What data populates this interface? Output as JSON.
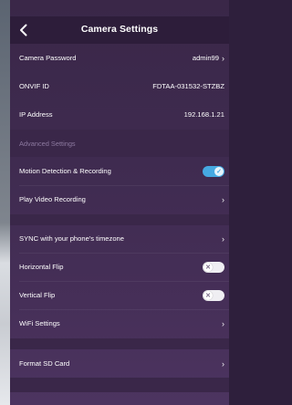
{
  "header": {
    "title": "Camera Settings"
  },
  "rows": {
    "camera_password": {
      "label": "Camera Password",
      "value": "admin99"
    },
    "onvif_id": {
      "label": "ONVIF ID",
      "value": "FDTAA-031532-STZBZ"
    },
    "ip_address": {
      "label": "IP Address",
      "value": "192.168.1.21"
    },
    "motion_detection": {
      "label": "Motion Detection & Recording",
      "state": "on"
    },
    "play_video_recording": {
      "label": "Play Video Recording"
    },
    "sync_timezone": {
      "label": "SYNC with your phone's timezone"
    },
    "horizontal_flip": {
      "label": "Horizontal Flip",
      "state": "off"
    },
    "vertical_flip": {
      "label": "Vertical Flip",
      "state": "off"
    },
    "wifi_settings": {
      "label": "WiFi Settings"
    },
    "format_sd_card": {
      "label": "Format SD Card"
    }
  },
  "sections": {
    "advanced": "Advanced Settings"
  },
  "glyphs": {
    "chevron": "›",
    "check": "✓",
    "cross": "✕",
    "back": "‹"
  },
  "colors": {
    "toggle_on": "#46a9e2",
    "toggle_off": "#efeef2",
    "background": "#3f2b50"
  }
}
